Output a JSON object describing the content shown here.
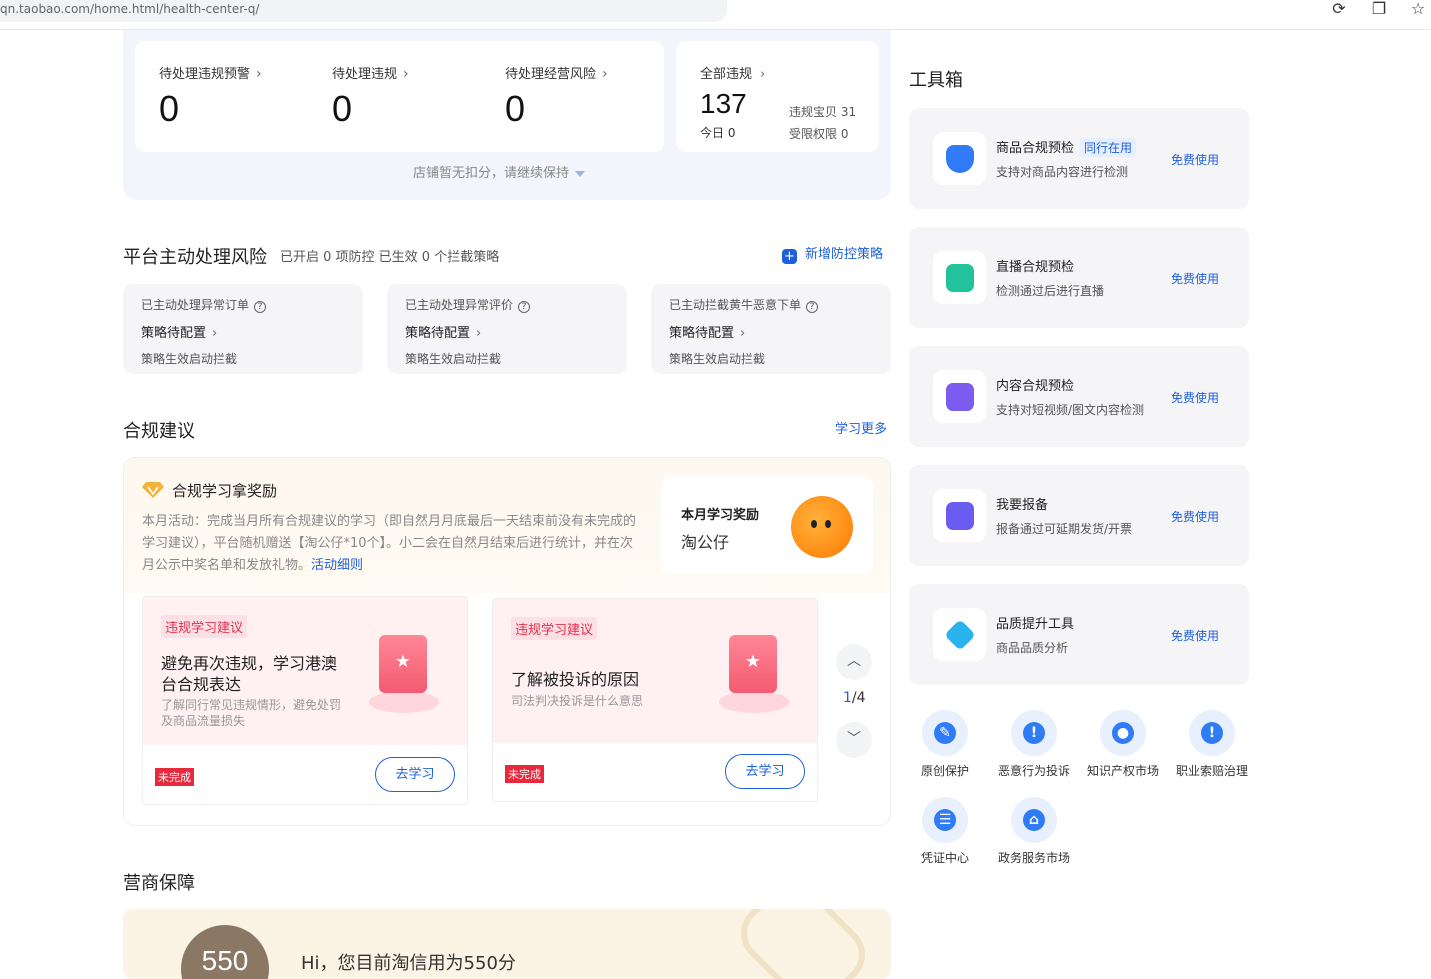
{
  "browser": {
    "url": "qn.taobao.com/home.html/health-center-q/"
  },
  "stats": {
    "items": [
      {
        "label": "待处理违规预警",
        "value": "0"
      },
      {
        "label": "待处理违规",
        "value": "0"
      },
      {
        "label": "待处理经营风险",
        "value": "0"
      }
    ],
    "total": {
      "label": "全部违规",
      "value": "137",
      "today": "今日 0",
      "item_violations": "违规宝贝 31",
      "restricted": "受限权限 0"
    },
    "keep_note": "店铺暂无扣分，请继续保持"
  },
  "risk": {
    "title": "平台主动处理风险",
    "subtitle": "已开启 0 项防控 已生效 0 个拦截策略",
    "add_label": "新增防控策略",
    "cards": [
      {
        "title": "已主动处理异常订单",
        "status": "策略待配置",
        "note": "策略生效启动拦截"
      },
      {
        "title": "已主动处理异常评价",
        "status": "策略待配置",
        "note": "策略生效启动拦截"
      },
      {
        "title": "已主动拦截黄牛恶意下单",
        "status": "策略待配置",
        "note": "策略生效启动拦截"
      }
    ]
  },
  "compliance": {
    "title": "合规建议",
    "more_label": "学习更多",
    "promo": {
      "title": "合规学习拿奖励",
      "desc": "本月活动：完成当月所有合规建议的学习（即自然月月底最后一天结束前没有未完成的学习建议），平台随机赠送【淘公仔*10个】。小二会在自然月结束后进行统计，并在次月公示中奖名单和发放礼物。",
      "link": "活动细则",
      "reward_label": "本月学习奖励",
      "reward_item": "淘公仔"
    },
    "cards": [
      {
        "tag": "违规学习建议",
        "title": "避免再次违规，学习港澳台合规表达",
        "sub": "了解同行常见违规情形，避免处罚及商品流量损失",
        "status": "未完成",
        "button": "去学习"
      },
      {
        "tag": "违规学习建议",
        "title": "了解被投诉的原因",
        "sub": "司法判决投诉是什么意思",
        "status": "未完成",
        "button": "去学习"
      }
    ],
    "pager": {
      "current": "1",
      "total": "/4"
    }
  },
  "guarantee": {
    "title": "营商保障",
    "score": "550",
    "greeting": "Hi，您目前淘信用为550分"
  },
  "toolbox": {
    "title": "工具箱",
    "tools": [
      {
        "name": "商品合规预检",
        "badge": "同行在用",
        "desc": "支持对商品内容进行检测",
        "action": "免费使用",
        "color": "#2f7cf6"
      },
      {
        "name": "直播合规预检",
        "badge": "",
        "desc": "检测通过后进行直播",
        "action": "免费使用",
        "color": "#22c39a"
      },
      {
        "name": "内容合规预检",
        "badge": "",
        "desc": "支持对短视频/图文内容检测",
        "action": "免费使用",
        "color": "#7a5cf0"
      },
      {
        "name": "我要报备",
        "badge": "",
        "desc": "报备通过可延期发货/开票",
        "action": "免费使用",
        "color": "#6a5cf0"
      },
      {
        "name": "品质提升工具",
        "badge": "",
        "desc": "商品品质分析",
        "action": "免费使用",
        "color": "#2bb3f0"
      }
    ],
    "quick": [
      {
        "label": "原创保护",
        "glyph": "✎"
      },
      {
        "label": "恶意行为投诉",
        "glyph": "!"
      },
      {
        "label": "知识产权市场",
        "glyph": "●"
      },
      {
        "label": "职业索赔治理",
        "glyph": "!"
      },
      {
        "label": "凭证中心",
        "glyph": "☰"
      },
      {
        "label": "政务服务市场",
        "glyph": "⌂"
      }
    ]
  }
}
